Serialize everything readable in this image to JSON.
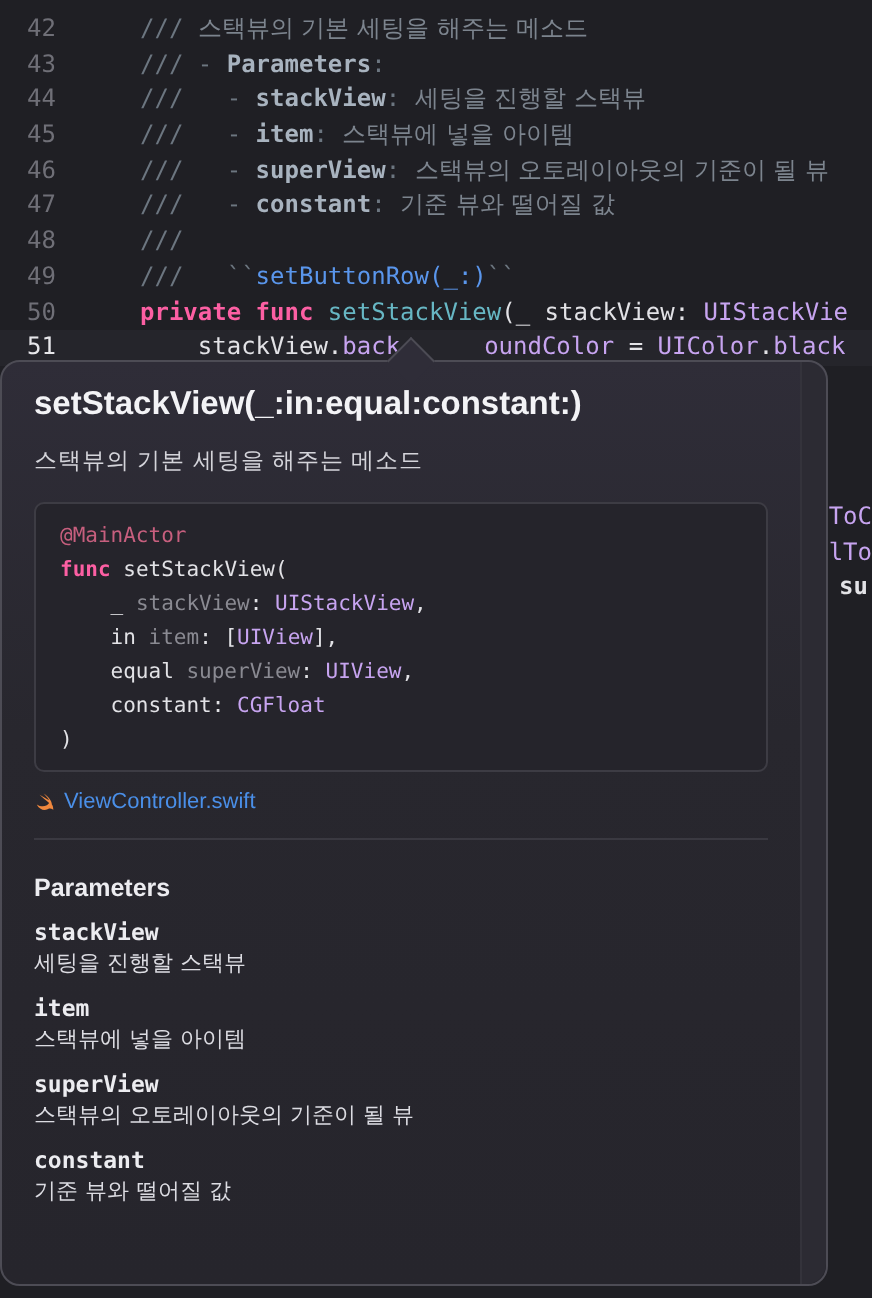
{
  "editor": {
    "lines": [
      {
        "number": "42",
        "current": false,
        "tokens": [
          {
            "text": "/// ",
            "kind": "comment"
          },
          {
            "text": "스택뷰의 기본 세팅을 해주는 메소드",
            "kind": "comment-text"
          }
        ]
      },
      {
        "number": "43",
        "current": false,
        "tokens": [
          {
            "text": "/// - ",
            "kind": "comment"
          },
          {
            "text": "Parameters",
            "kind": "doc"
          },
          {
            "text": ":",
            "kind": "comment"
          }
        ]
      },
      {
        "number": "44",
        "current": false,
        "tokens": [
          {
            "text": "///   - ",
            "kind": "comment"
          },
          {
            "text": "stackView",
            "kind": "doc"
          },
          {
            "text": ": ",
            "kind": "comment"
          },
          {
            "text": "세팅을 진행할 스택뷰",
            "kind": "comment-text"
          }
        ]
      },
      {
        "number": "45",
        "current": false,
        "tokens": [
          {
            "text": "///   - ",
            "kind": "comment"
          },
          {
            "text": "item",
            "kind": "doc"
          },
          {
            "text": ": ",
            "kind": "comment"
          },
          {
            "text": "스택뷰에 넣을 아이템",
            "kind": "comment-text"
          }
        ]
      },
      {
        "number": "46",
        "current": false,
        "tokens": [
          {
            "text": "///   - ",
            "kind": "comment"
          },
          {
            "text": "superView",
            "kind": "doc"
          },
          {
            "text": ": ",
            "kind": "comment"
          },
          {
            "text": "스택뷰의 오토레이아웃의 기준이 될 뷰",
            "kind": "comment-text"
          }
        ]
      },
      {
        "number": "47",
        "current": false,
        "tokens": [
          {
            "text": "///   - ",
            "kind": "comment"
          },
          {
            "text": "constant",
            "kind": "doc"
          },
          {
            "text": ": ",
            "kind": "comment"
          },
          {
            "text": "기준 뷰와 떨어질 값",
            "kind": "comment-text"
          }
        ]
      },
      {
        "number": "48",
        "current": false,
        "tokens": [
          {
            "text": "///",
            "kind": "comment"
          }
        ]
      },
      {
        "number": "49",
        "current": false,
        "tokens": [
          {
            "text": "///   ``",
            "kind": "comment"
          },
          {
            "text": "setButtonRow(_:)",
            "kind": "link"
          },
          {
            "text": "``",
            "kind": "comment"
          }
        ]
      },
      {
        "number": "50",
        "current": false,
        "tokens": [
          {
            "text": "private func ",
            "kind": "keyword"
          },
          {
            "text": "setStackView",
            "kind": "func"
          },
          {
            "text": "(_ stackView: ",
            "kind": "plain"
          },
          {
            "text": "UIStackVie",
            "kind": "type"
          }
        ]
      },
      {
        "number": "51",
        "current": true,
        "tokens": [
          {
            "text": "    stackView.",
            "kind": "plain"
          },
          {
            "text": "back",
            "kind": "type"
          }
        ],
        "tokens_after_pointer": [
          {
            "text": "oundColor",
            "kind": "type"
          },
          {
            "text": " = ",
            "kind": "plain"
          },
          {
            "text": "UIColor",
            "kind": "type"
          },
          {
            "text": ".",
            "kind": "plain"
          },
          {
            "text": "black",
            "kind": "type"
          }
        ]
      }
    ],
    "clipped_fragments": [
      {
        "text": "ToC",
        "kind": "type"
      },
      {
        "text": "lTo",
        "kind": "type"
      },
      {
        "text": "su",
        "kind": "plain"
      }
    ]
  },
  "popover": {
    "title": "setStackView(_:in:equal:constant:)",
    "summary": "스택뷰의 기본 세팅을 해주는 메소드",
    "declaration": [
      [
        {
          "text": "@MainActor",
          "kind": "attribute"
        }
      ],
      [
        {
          "text": "func",
          "kind": "keyword"
        },
        {
          "text": " setStackView(",
          "kind": "plain"
        }
      ],
      [
        {
          "text": "    _ ",
          "kind": "plain"
        },
        {
          "text": "stackView",
          "kind": "param"
        },
        {
          "text": ": ",
          "kind": "plain"
        },
        {
          "text": "UIStackView",
          "kind": "type"
        },
        {
          "text": ",",
          "kind": "plain"
        }
      ],
      [
        {
          "text": "    in ",
          "kind": "plain"
        },
        {
          "text": "item",
          "kind": "param"
        },
        {
          "text": ": [",
          "kind": "plain"
        },
        {
          "text": "UIView",
          "kind": "type"
        },
        {
          "text": "],",
          "kind": "plain"
        }
      ],
      [
        {
          "text": "    equal ",
          "kind": "plain"
        },
        {
          "text": "superView",
          "kind": "param"
        },
        {
          "text": ": ",
          "kind": "plain"
        },
        {
          "text": "UIView",
          "kind": "type"
        },
        {
          "text": ",",
          "kind": "plain"
        }
      ],
      [
        {
          "text": "    constant: ",
          "kind": "plain"
        },
        {
          "text": "CGFloat",
          "kind": "type"
        }
      ],
      [
        {
          "text": ")",
          "kind": "plain"
        }
      ]
    ],
    "source_file": "ViewController.swift",
    "parameters_heading": "Parameters",
    "parameters": [
      {
        "name": "stackView",
        "description": "세팅을 진행할 스택뷰"
      },
      {
        "name": "item",
        "description": "스택뷰에 넣을 아이템"
      },
      {
        "name": "superView",
        "description": "스택뷰의 오토레이아웃의 기준이 될 뷰"
      },
      {
        "name": "constant",
        "description": "기준 뷰와 떨어질 값"
      }
    ]
  }
}
